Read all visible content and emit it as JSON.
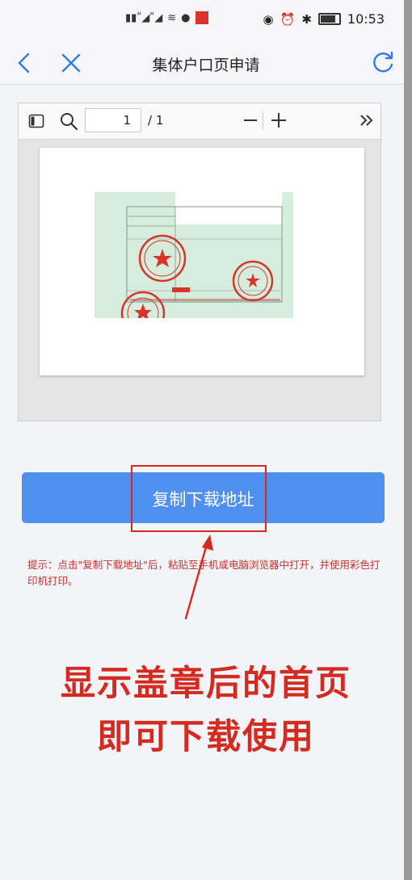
{
  "status_bar": {
    "time": "10:53",
    "icons": [
      "signal-icon",
      "signal-icon",
      "wifi-icon",
      "chat-icon",
      "app-badge-icon",
      "eye-icon",
      "alarm-icon",
      "bluetooth-icon",
      "battery-icon"
    ]
  },
  "nav": {
    "title": "集体户口页申请",
    "back_icon": "chevron-left-icon",
    "close_icon": "close-icon",
    "refresh_icon": "refresh-icon"
  },
  "pdf_toolbar": {
    "page_input_value": "1",
    "page_total": "/ 1",
    "icons": [
      "sidebar-toggle-icon",
      "search-icon",
      "zoom-out-icon",
      "zoom-in-icon",
      "more-tools-icon"
    ]
  },
  "document_preview": {
    "description_icon": "stamped-household-register-image"
  },
  "main": {
    "copy_button_label": "复制下载地址",
    "hint_text": "提示：点击\"复制下载地址\"后，粘贴至手机或电脑浏览器中打开，并使用彩色打印机打印。"
  },
  "annotation": {
    "caption_line1": "显示盖章后的首页",
    "caption_line2": "即可下载使用",
    "color": "#d42a20"
  },
  "colors": {
    "button_blue": "#4e8ff0",
    "accent_blue": "#2f7be6"
  }
}
